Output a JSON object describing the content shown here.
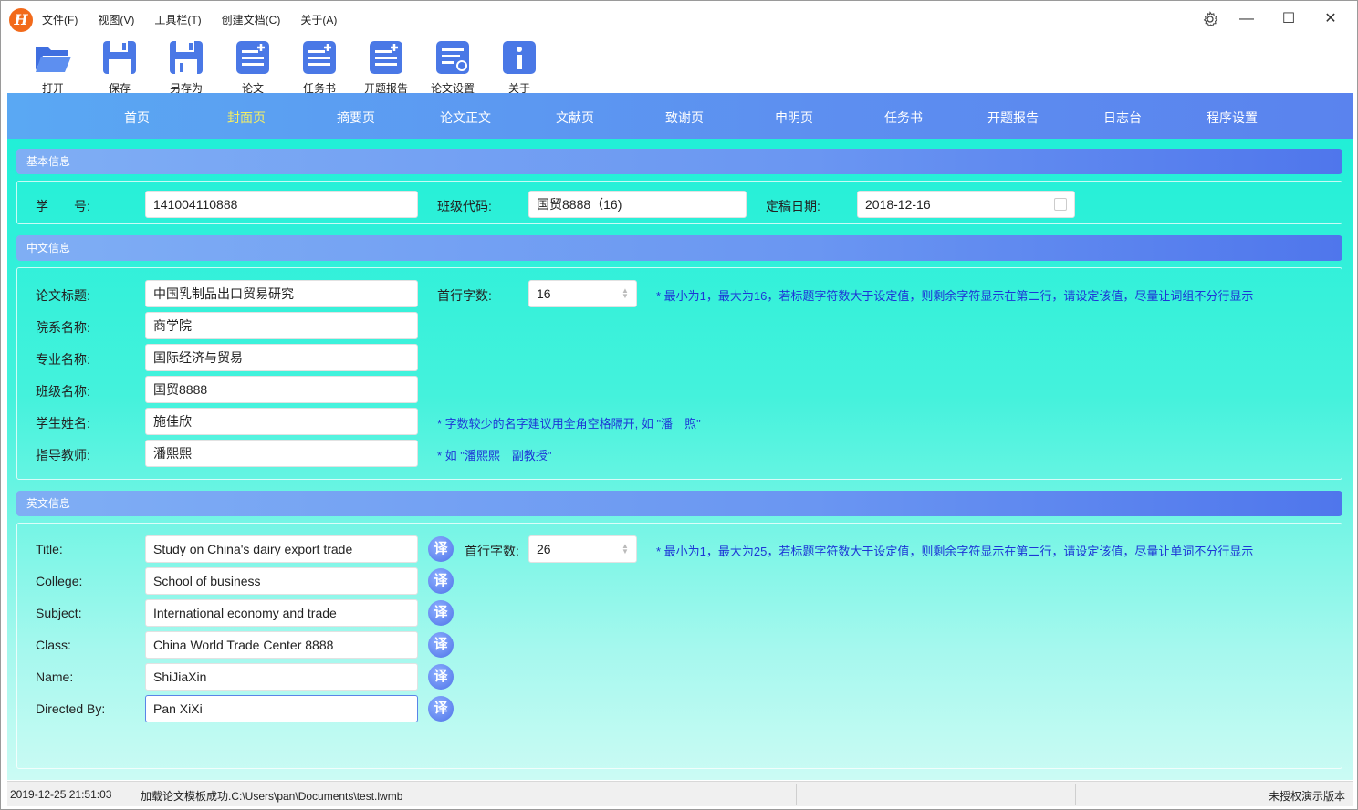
{
  "app": {
    "logo_letter": "H"
  },
  "menu": [
    "文件(F)",
    "视图(V)",
    "工具栏(T)",
    "创建文档(C)",
    "关于(A)"
  ],
  "toolbar": [
    {
      "label": "打开",
      "icon": "folder-open-icon"
    },
    {
      "label": "保存",
      "icon": "save-icon"
    },
    {
      "label": "另存为",
      "icon": "save-as-icon"
    },
    {
      "label": "论文",
      "icon": "document-add-icon"
    },
    {
      "label": "任务书",
      "icon": "document-add-icon"
    },
    {
      "label": "开题报告",
      "icon": "document-add-icon"
    },
    {
      "label": "论文设置",
      "icon": "document-settings-icon"
    },
    {
      "label": "关于",
      "icon": "info-icon"
    }
  ],
  "nav": [
    "首页",
    "封面页",
    "摘要页",
    "论文正文",
    "文献页",
    "致谢页",
    "申明页",
    "任务书",
    "开题报告",
    "日志台",
    "程序设置"
  ],
  "nav_active": "封面页",
  "basic": {
    "title": "基本信息",
    "student_id_label": "学　　号:",
    "student_id": "141004110888",
    "class_code_label": "班级代码:",
    "class_code": "国贸8888（16)",
    "final_date_label": "定稿日期:",
    "final_date": "2018-12-16"
  },
  "chinese": {
    "title": "中文信息",
    "thesis_title_label": "论文标题:",
    "thesis_title": "中国乳制品出口贸易研究",
    "first_line_label": "首行字数:",
    "first_line": "16",
    "first_line_hint": "* 最小为1，最大为16，若标题字符数大于设定值，则剩余字符显示在第二行，请设定该值，尽量让词组不分行显示",
    "dept_label": "院系名称:",
    "dept": "商学院",
    "major_label": "专业名称:",
    "major": "国际经济与贸易",
    "class_label": "班级名称:",
    "class": "国贸8888",
    "student_label": "学生姓名:",
    "student": "施佳欣",
    "student_hint": "* 字数较少的名字建议用全角空格隔开, 如 \"潘　煦\"",
    "teacher_label": "指导教师:",
    "teacher": "潘熙熙",
    "teacher_hint": "* 如 \"潘熙熙　副教授\""
  },
  "english": {
    "title": "英文信息",
    "translate_label": "译",
    "title_label": "Title:",
    "title_value": "Study on China's dairy export trade",
    "first_line_label": "首行字数:",
    "first_line": "26",
    "first_line_hint": "* 最小为1，最大为25，若标题字符数大于设定值，则剩余字符显示在第二行，请设定该值，尽量让单词不分行显示",
    "college_label": "College:",
    "college": "School of business",
    "subject_label": "Subject:",
    "subject": "International economy and trade",
    "class_label": "Class:",
    "class": "China World Trade Center 8888",
    "name_label": "Name:",
    "name": "ShiJiaXin",
    "directed_label": "Directed By:",
    "directed": "Pan XiXi"
  },
  "status": {
    "time": "2019-12-25 21:51:03",
    "message": "加载论文模板成功.C:\\Users\\pan\\Documents\\test.lwmb",
    "license": "未授权演示版本"
  },
  "colors": {
    "accent": "#5a84ee",
    "content_bg": "#21efd7",
    "hint": "#1d36d6",
    "logo": "#f26a1b"
  }
}
